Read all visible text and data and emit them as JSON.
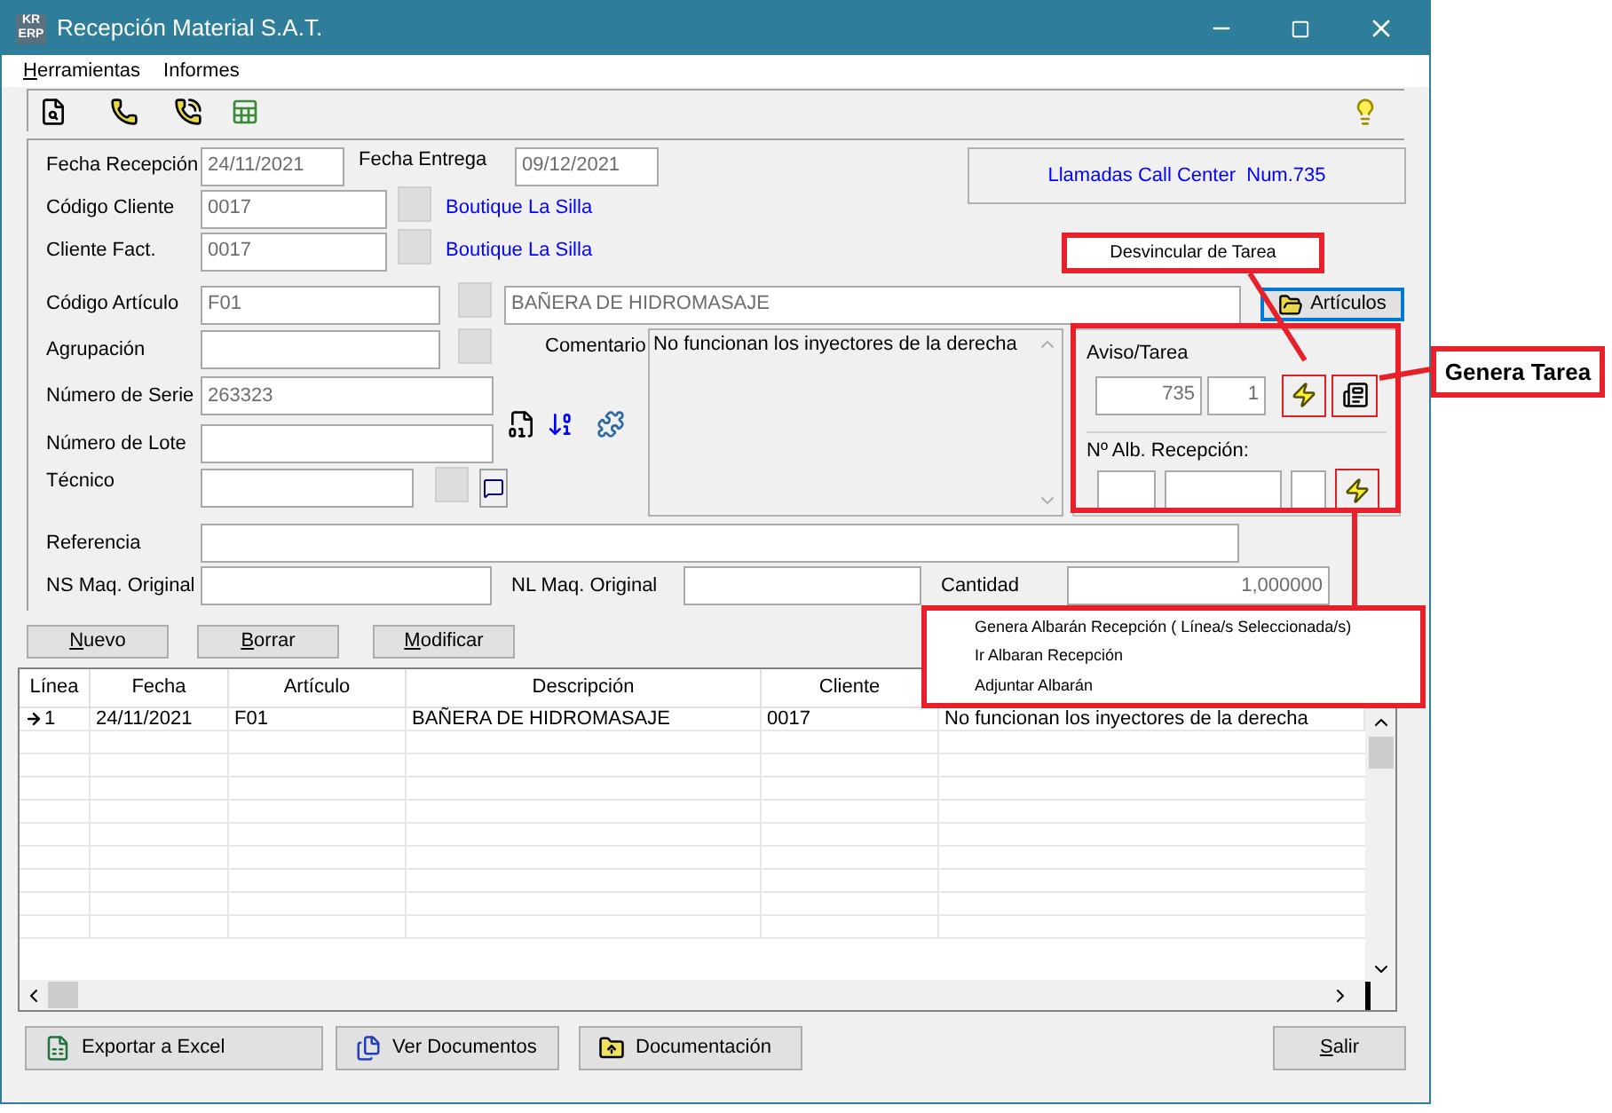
{
  "window": {
    "title": "Recepción Material S.A.T.",
    "logo": {
      "top": "KR",
      "bottom": "ERP"
    }
  },
  "menu": [
    {
      "label": "Herramientas",
      "underline_first": true
    },
    {
      "label": "Informes",
      "underline_first": false
    }
  ],
  "form": {
    "fecha_recepcion": {
      "label": "Fecha Recepción",
      "value": "24/11/2021"
    },
    "fecha_entrega": {
      "label": "Fecha Entrega",
      "value": "09/12/2021"
    },
    "call_center": "Llamadas Call Center  Num.735",
    "codigo_cliente": {
      "label": "Código Cliente",
      "value": "0017",
      "link": "Boutique La Silla"
    },
    "cliente_fact": {
      "label": "Cliente Fact.",
      "value": "0017",
      "link": "Boutique La Silla"
    },
    "codigo_articulo": {
      "label": "Código Artículo",
      "value": "F01",
      "description": "BAÑERA DE HIDROMASAJE"
    },
    "articulos_button": "Artículos",
    "agrupacion": {
      "label": "Agrupación"
    },
    "numero_serie": {
      "label": "Número de Serie",
      "value": "263323"
    },
    "numero_lote": {
      "label": "Número de Lote"
    },
    "tecnico": {
      "label": "Técnico"
    },
    "comentario": {
      "label": "Comentario",
      "value": "No funcionan los inyectores de la derecha"
    },
    "aviso": {
      "title": "Aviso/Tarea",
      "number": "735",
      "line": "1"
    },
    "albaran": {
      "title": "Nº Alb. Recepción:"
    },
    "referencia": {
      "label": "Referencia"
    },
    "ns_maq": {
      "label": "NS Maq. Original"
    },
    "nl_maq": {
      "label": "NL Maq. Original"
    },
    "cantidad": {
      "label": "Cantidad",
      "value": "1,000000"
    }
  },
  "actions": [
    {
      "label": "Nuevo",
      "underline_first": true
    },
    {
      "label": "Borrar",
      "underline_first": true
    },
    {
      "label": "Modificar",
      "underline_first": true
    }
  ],
  "table": {
    "columns": [
      "Línea",
      "Fecha",
      "Artículo",
      "Descripción",
      "Cliente"
    ],
    "rows": [
      {
        "current": true,
        "cells": [
          "1",
          "24/11/2021",
          "F01",
          "BAÑERA DE HIDROMASAJE",
          "0017",
          "No funcionan los inyectores de la derecha"
        ]
      }
    ]
  },
  "footer": [
    {
      "kind": "excel",
      "label": "Exportar a Excel",
      "underline_first": false
    },
    {
      "kind": "docs",
      "label": "Ver Documentos",
      "underline_first": false
    },
    {
      "kind": "folder",
      "label": "Documentación",
      "underline_first": false
    },
    {
      "kind": "exit",
      "label": "Salir",
      "underline_first": true
    }
  ],
  "annotations": {
    "desvincular": "Desvincular de Tarea",
    "genera_tarea": "Genera Tarea",
    "menu": [
      "Genera Albarán Recepción ( Línea/s Seleccionada/s)",
      "Ir Albaran Recepción",
      "Adjuntar Albarán"
    ]
  }
}
